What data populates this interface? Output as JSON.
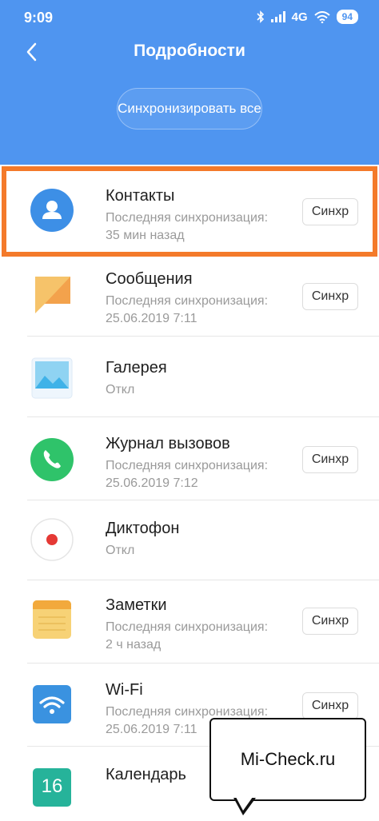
{
  "status_bar": {
    "time": "9:09",
    "network": "4G",
    "battery": "94"
  },
  "header": {
    "title": "Подробности",
    "sync_all_label": "Синхронизировать все"
  },
  "items": [
    {
      "title": "Контакты",
      "sub1": "Последняя синхронизация:",
      "sub2": "35 мин назад",
      "button": "Синхр",
      "icon": "contact-icon"
    },
    {
      "title": "Сообщения",
      "sub1": "Последняя синхронизация:",
      "sub2": "25.06.2019 7:11",
      "button": "Синхр",
      "icon": "message-icon"
    },
    {
      "title": "Галерея",
      "sub1": "Откл",
      "icon": "gallery-icon"
    },
    {
      "title": "Журнал вызовов",
      "sub1": "Последняя синхронизация:",
      "sub2": "25.06.2019 7:12",
      "button": "Синхр",
      "icon": "phone-icon"
    },
    {
      "title": "Диктофон",
      "sub1": "Откл",
      "icon": "recorder-icon"
    },
    {
      "title": "Заметки",
      "sub1": "Последняя синхронизация:",
      "sub2": "2 ч назад",
      "button": "Синхр",
      "icon": "notes-icon"
    },
    {
      "title": "Wi-Fi",
      "sub1": "Последняя синхронизация:",
      "sub2": "25.06.2019 7:11",
      "button": "Синхр",
      "icon": "wifi-icon"
    },
    {
      "title": "Календарь",
      "sub1": "",
      "calendar_day": "16",
      "icon": "calendar-icon"
    }
  ],
  "watermark": "Mi-Check.ru",
  "colors": {
    "header": "#4f95f0",
    "highlight": "#f47a2a"
  }
}
